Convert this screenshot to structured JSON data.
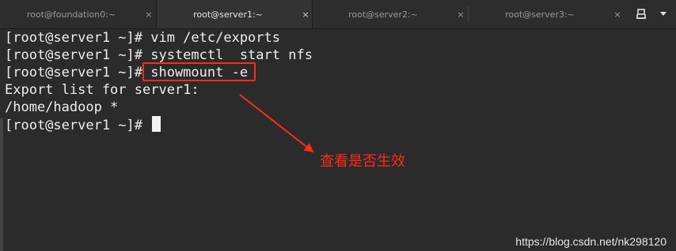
{
  "tabs": [
    {
      "label": "root@foundation0:~",
      "active": false
    },
    {
      "label": "root@server1:~",
      "active": true
    },
    {
      "label": "root@server2:~",
      "active": false
    },
    {
      "label": "root@server3:~",
      "active": false
    }
  ],
  "toolbar": {
    "close_glyph": "×",
    "new_tab_icon": "new-tab-icon",
    "menu_icon": "dropdown-arrow-icon"
  },
  "terminal": {
    "lines": [
      {
        "prompt": "[root@server1 ~]# ",
        "text": "vim /etc/exports"
      },
      {
        "prompt": "[root@server1 ~]# ",
        "text": "systemctl  start nfs"
      },
      {
        "prompt": "[root@server1 ~]# ",
        "text": "showmount -e"
      },
      {
        "prompt": "",
        "text": "Export list for server1:"
      },
      {
        "prompt": "",
        "text": "/home/hadoop *"
      },
      {
        "prompt": "[root@server1 ~]# ",
        "text": ""
      }
    ]
  },
  "annotation": {
    "note": "查看是否生效",
    "color": "#ff2a1a"
  },
  "watermark": "https://blog.csdn.net/nk298120"
}
